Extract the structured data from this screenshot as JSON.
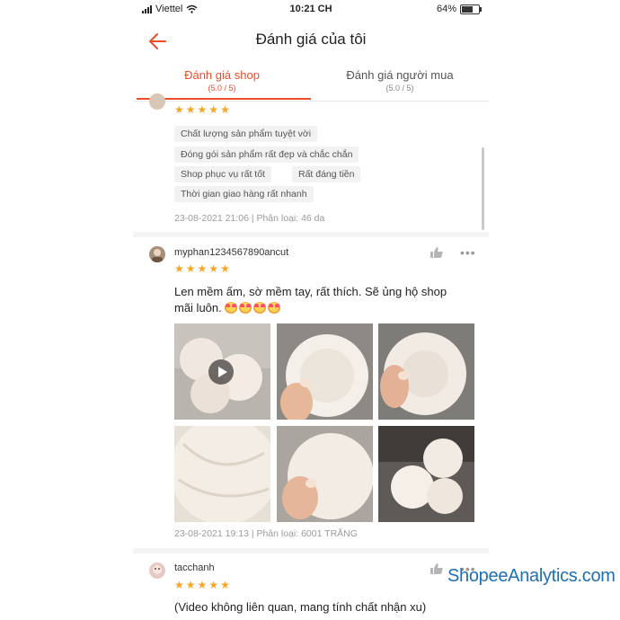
{
  "status_bar": {
    "carrier": "Viettel",
    "time": "10:21 CH",
    "battery": "64%"
  },
  "header": {
    "title": "Đánh giá của tôi",
    "back_icon": "back-arrow-icon",
    "accent_color": "#ee4d2d"
  },
  "tabs": [
    {
      "label": "Đánh giá shop",
      "sub": "(5.0 / 5)"
    },
    {
      "label": "Đánh giá người mua",
      "sub": "(5.0 / 5)"
    }
  ],
  "reviews": [
    {
      "rating": 5,
      "tags": [
        "Chất lượng sản phẩm tuyệt vời",
        "Đóng gói sản phẩm rất đẹp và chắc chắn",
        "Shop phục vụ rất tốt",
        "Rất đáng tiền",
        "Thời gian giao hàng rất nhanh"
      ],
      "meta": "23-08-2021 21:06 | Phân loại: 46 da"
    },
    {
      "username": "myphan1234567890ancut",
      "rating": 5,
      "text_line1": "Len mềm ấm, sờ mềm tay, rất thích. Sẽ ủng hộ shop",
      "text_line2": "mãi luôn.",
      "emoji_count": 4,
      "photo_count": 6,
      "meta": "23-08-2021 19:13 | Phân loại: 6001 TRẮNG"
    },
    {
      "username": "tacchanh",
      "rating": 5,
      "text_line1": "(Video không liên quan, mang tính chất nhận xu)"
    }
  ],
  "watermark": "ShopeeAnalytics.com"
}
